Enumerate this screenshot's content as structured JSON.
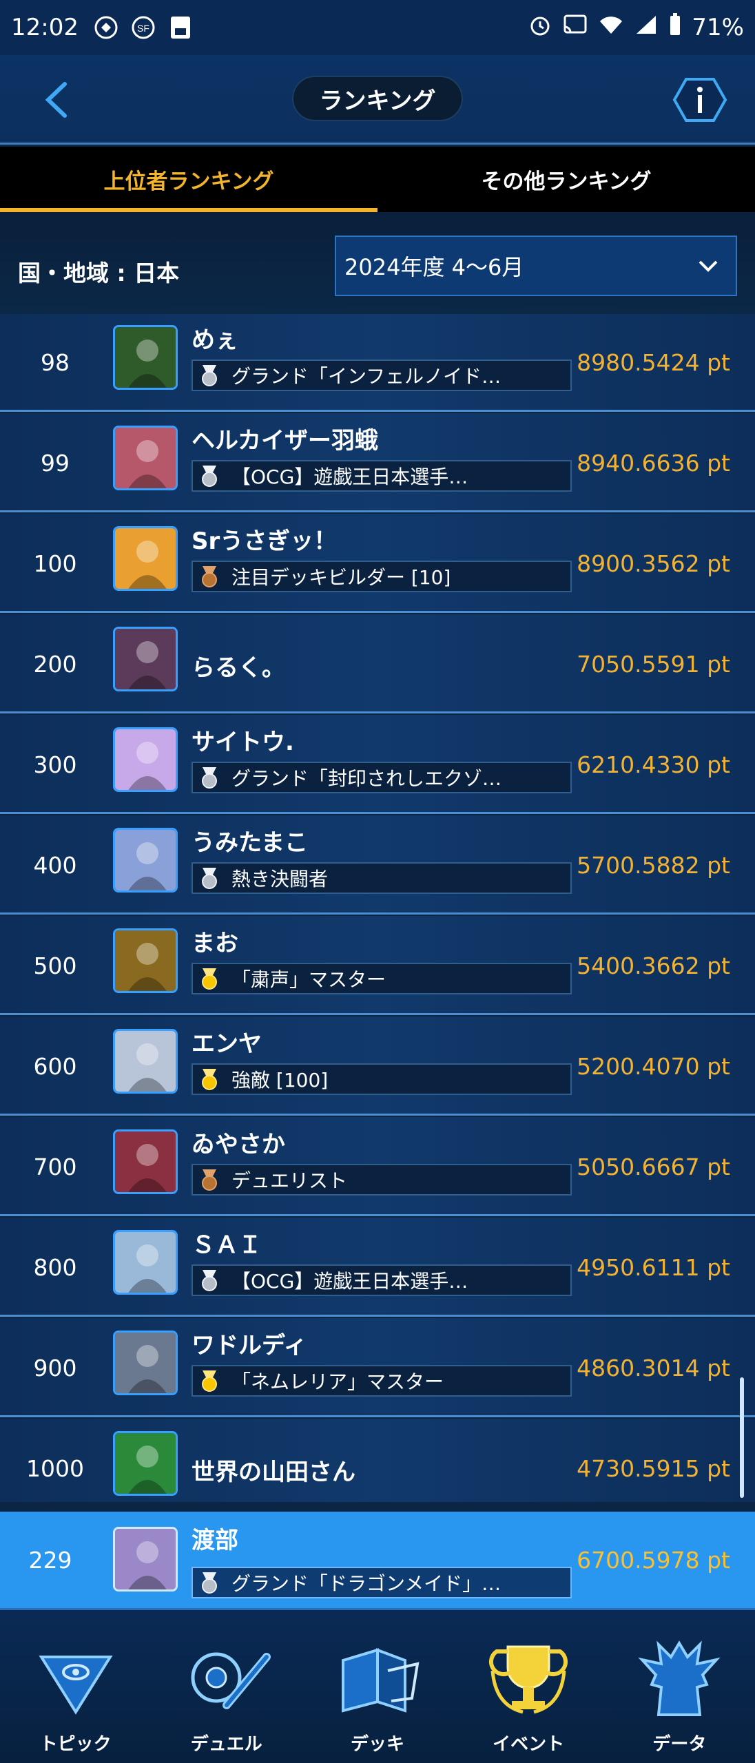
{
  "status_bar": {
    "time": "12:02",
    "battery": "71%"
  },
  "header": {
    "title": "ランキング"
  },
  "tabs": [
    {
      "label": "上位者ランキング",
      "active": true
    },
    {
      "label": "その他ランキング",
      "active": false
    }
  ],
  "filter": {
    "region": "国・地域 : 日本",
    "period": "2024年度 4〜6月"
  },
  "rows": [
    {
      "rank": "98",
      "name": "めぇ",
      "title": "グランド「インフェルノイド…",
      "medal": "silver",
      "points": "8980.5424 pt",
      "avatar_color": "#2f5a2a"
    },
    {
      "rank": "99",
      "name": "ヘルカイザー羽蛾",
      "title": "【OCG】遊戯王日本選手…",
      "medal": "silver",
      "points": "8940.6636 pt",
      "avatar_color": "#b7586a"
    },
    {
      "rank": "100",
      "name": "Srうさぎッ！",
      "title": "注目デッキビルダー [10]",
      "medal": "bronze",
      "points": "8900.3562 pt",
      "avatar_color": "#e9a030"
    },
    {
      "rank": "200",
      "name": "らるく。",
      "title": "",
      "medal": "",
      "points": "7050.5591 pt",
      "avatar_color": "#5b3a5a"
    },
    {
      "rank": "300",
      "name": "サイトウ.",
      "title": "グランド「封印されしエクゾ…",
      "medal": "silver",
      "points": "6210.4330 pt",
      "avatar_color": "#c7a8e8"
    },
    {
      "rank": "400",
      "name": "うみたまこ",
      "title": "熱き決闘者",
      "medal": "silver",
      "points": "5700.5882 pt",
      "avatar_color": "#8aa0d8"
    },
    {
      "rank": "500",
      "name": "まお",
      "title": "「粛声」マスター",
      "medal": "gold",
      "points": "5400.3662 pt",
      "avatar_color": "#8a6a20"
    },
    {
      "rank": "600",
      "name": "エンヤ",
      "title": "強敵 [100]",
      "medal": "gold",
      "points": "5200.4070 pt",
      "avatar_color": "#b8c4d8"
    },
    {
      "rank": "700",
      "name": "ゐやさか",
      "title": "デュエリスト",
      "medal": "bronze",
      "points": "5050.6667 pt",
      "avatar_color": "#8a3040"
    },
    {
      "rank": "800",
      "name": "ＳＡＩ",
      "title": "【OCG】遊戯王日本選手…",
      "medal": "silver",
      "points": "4950.6111 pt",
      "avatar_color": "#9ab8d8"
    },
    {
      "rank": "900",
      "name": "ワドルディ",
      "title": "「ネムレリア」マスター",
      "medal": "gold",
      "points": "4860.3014 pt",
      "avatar_color": "#6a7890"
    },
    {
      "rank": "1000",
      "name": "世界の山田さん",
      "title": "",
      "medal": "",
      "points": "4730.5915 pt",
      "avatar_color": "#2a8a3a"
    }
  ],
  "my_row": {
    "rank": "229",
    "name": "渡部",
    "title": "グランド「ドラゴンメイド」…",
    "medal": "silver",
    "points": "6700.5978 pt",
    "avatar_color": "#9a88c8"
  },
  "nav": [
    {
      "label": "トピック"
    },
    {
      "label": "デュエル"
    },
    {
      "label": "デッキ"
    },
    {
      "label": "イベント"
    },
    {
      "label": "データ"
    }
  ],
  "colors": {
    "points": "#f2b233",
    "tab_active": "#f3b52b",
    "my_row_bg": "#2996ef"
  }
}
